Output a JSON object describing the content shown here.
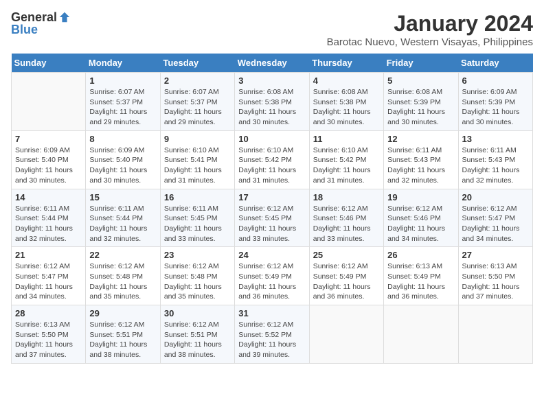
{
  "logo": {
    "general": "General",
    "blue": "Blue"
  },
  "title": "January 2024",
  "subtitle": "Barotac Nuevo, Western Visayas, Philippines",
  "days_header": [
    "Sunday",
    "Monday",
    "Tuesday",
    "Wednesday",
    "Thursday",
    "Friday",
    "Saturday"
  ],
  "weeks": [
    [
      {
        "day": "",
        "sunrise": "",
        "sunset": "",
        "daylight": ""
      },
      {
        "day": "1",
        "sunrise": "Sunrise: 6:07 AM",
        "sunset": "Sunset: 5:37 PM",
        "daylight": "Daylight: 11 hours and 29 minutes."
      },
      {
        "day": "2",
        "sunrise": "Sunrise: 6:07 AM",
        "sunset": "Sunset: 5:37 PM",
        "daylight": "Daylight: 11 hours and 29 minutes."
      },
      {
        "day": "3",
        "sunrise": "Sunrise: 6:08 AM",
        "sunset": "Sunset: 5:38 PM",
        "daylight": "Daylight: 11 hours and 30 minutes."
      },
      {
        "day": "4",
        "sunrise": "Sunrise: 6:08 AM",
        "sunset": "Sunset: 5:38 PM",
        "daylight": "Daylight: 11 hours and 30 minutes."
      },
      {
        "day": "5",
        "sunrise": "Sunrise: 6:08 AM",
        "sunset": "Sunset: 5:39 PM",
        "daylight": "Daylight: 11 hours and 30 minutes."
      },
      {
        "day": "6",
        "sunrise": "Sunrise: 6:09 AM",
        "sunset": "Sunset: 5:39 PM",
        "daylight": "Daylight: 11 hours and 30 minutes."
      }
    ],
    [
      {
        "day": "7",
        "sunrise": "Sunrise: 6:09 AM",
        "sunset": "Sunset: 5:40 PM",
        "daylight": "Daylight: 11 hours and 30 minutes."
      },
      {
        "day": "8",
        "sunrise": "Sunrise: 6:09 AM",
        "sunset": "Sunset: 5:40 PM",
        "daylight": "Daylight: 11 hours and 30 minutes."
      },
      {
        "day": "9",
        "sunrise": "Sunrise: 6:10 AM",
        "sunset": "Sunset: 5:41 PM",
        "daylight": "Daylight: 11 hours and 31 minutes."
      },
      {
        "day": "10",
        "sunrise": "Sunrise: 6:10 AM",
        "sunset": "Sunset: 5:42 PM",
        "daylight": "Daylight: 11 hours and 31 minutes."
      },
      {
        "day": "11",
        "sunrise": "Sunrise: 6:10 AM",
        "sunset": "Sunset: 5:42 PM",
        "daylight": "Daylight: 11 hours and 31 minutes."
      },
      {
        "day": "12",
        "sunrise": "Sunrise: 6:11 AM",
        "sunset": "Sunset: 5:43 PM",
        "daylight": "Daylight: 11 hours and 32 minutes."
      },
      {
        "day": "13",
        "sunrise": "Sunrise: 6:11 AM",
        "sunset": "Sunset: 5:43 PM",
        "daylight": "Daylight: 11 hours and 32 minutes."
      }
    ],
    [
      {
        "day": "14",
        "sunrise": "Sunrise: 6:11 AM",
        "sunset": "Sunset: 5:44 PM",
        "daylight": "Daylight: 11 hours and 32 minutes."
      },
      {
        "day": "15",
        "sunrise": "Sunrise: 6:11 AM",
        "sunset": "Sunset: 5:44 PM",
        "daylight": "Daylight: 11 hours and 32 minutes."
      },
      {
        "day": "16",
        "sunrise": "Sunrise: 6:11 AM",
        "sunset": "Sunset: 5:45 PM",
        "daylight": "Daylight: 11 hours and 33 minutes."
      },
      {
        "day": "17",
        "sunrise": "Sunrise: 6:12 AM",
        "sunset": "Sunset: 5:45 PM",
        "daylight": "Daylight: 11 hours and 33 minutes."
      },
      {
        "day": "18",
        "sunrise": "Sunrise: 6:12 AM",
        "sunset": "Sunset: 5:46 PM",
        "daylight": "Daylight: 11 hours and 33 minutes."
      },
      {
        "day": "19",
        "sunrise": "Sunrise: 6:12 AM",
        "sunset": "Sunset: 5:46 PM",
        "daylight": "Daylight: 11 hours and 34 minutes."
      },
      {
        "day": "20",
        "sunrise": "Sunrise: 6:12 AM",
        "sunset": "Sunset: 5:47 PM",
        "daylight": "Daylight: 11 hours and 34 minutes."
      }
    ],
    [
      {
        "day": "21",
        "sunrise": "Sunrise: 6:12 AM",
        "sunset": "Sunset: 5:47 PM",
        "daylight": "Daylight: 11 hours and 34 minutes."
      },
      {
        "day": "22",
        "sunrise": "Sunrise: 6:12 AM",
        "sunset": "Sunset: 5:48 PM",
        "daylight": "Daylight: 11 hours and 35 minutes."
      },
      {
        "day": "23",
        "sunrise": "Sunrise: 6:12 AM",
        "sunset": "Sunset: 5:48 PM",
        "daylight": "Daylight: 11 hours and 35 minutes."
      },
      {
        "day": "24",
        "sunrise": "Sunrise: 6:12 AM",
        "sunset": "Sunset: 5:49 PM",
        "daylight": "Daylight: 11 hours and 36 minutes."
      },
      {
        "day": "25",
        "sunrise": "Sunrise: 6:12 AM",
        "sunset": "Sunset: 5:49 PM",
        "daylight": "Daylight: 11 hours and 36 minutes."
      },
      {
        "day": "26",
        "sunrise": "Sunrise: 6:13 AM",
        "sunset": "Sunset: 5:49 PM",
        "daylight": "Daylight: 11 hours and 36 minutes."
      },
      {
        "day": "27",
        "sunrise": "Sunrise: 6:13 AM",
        "sunset": "Sunset: 5:50 PM",
        "daylight": "Daylight: 11 hours and 37 minutes."
      }
    ],
    [
      {
        "day": "28",
        "sunrise": "Sunrise: 6:13 AM",
        "sunset": "Sunset: 5:50 PM",
        "daylight": "Daylight: 11 hours and 37 minutes."
      },
      {
        "day": "29",
        "sunrise": "Sunrise: 6:12 AM",
        "sunset": "Sunset: 5:51 PM",
        "daylight": "Daylight: 11 hours and 38 minutes."
      },
      {
        "day": "30",
        "sunrise": "Sunrise: 6:12 AM",
        "sunset": "Sunset: 5:51 PM",
        "daylight": "Daylight: 11 hours and 38 minutes."
      },
      {
        "day": "31",
        "sunrise": "Sunrise: 6:12 AM",
        "sunset": "Sunset: 5:52 PM",
        "daylight": "Daylight: 11 hours and 39 minutes."
      },
      {
        "day": "",
        "sunrise": "",
        "sunset": "",
        "daylight": ""
      },
      {
        "day": "",
        "sunrise": "",
        "sunset": "",
        "daylight": ""
      },
      {
        "day": "",
        "sunrise": "",
        "sunset": "",
        "daylight": ""
      }
    ]
  ]
}
